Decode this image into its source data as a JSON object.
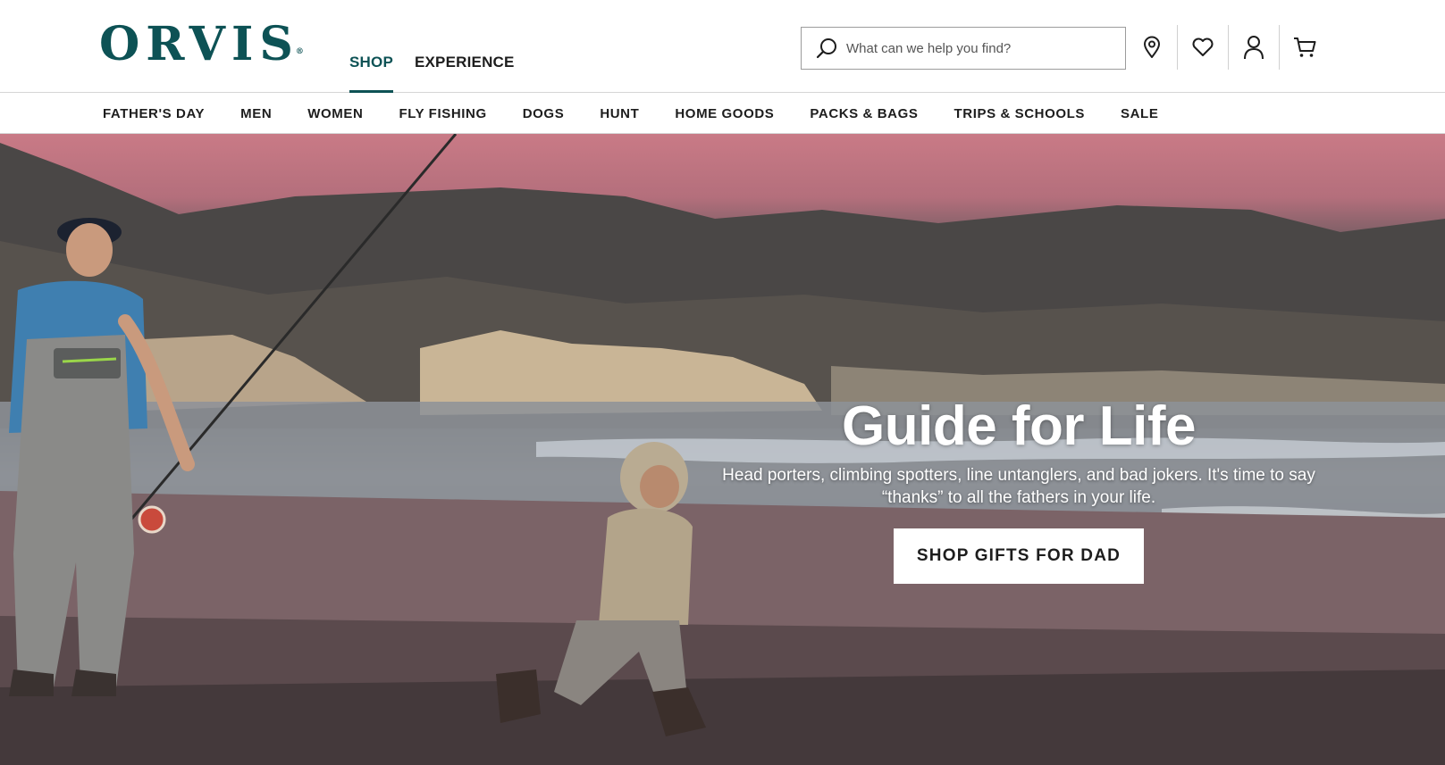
{
  "brand": {
    "logo_text": "ORVIS",
    "logo_mark": "®",
    "color": "#0d5255"
  },
  "top_nav": [
    {
      "label": "SHOP",
      "active": true
    },
    {
      "label": "EXPERIENCE",
      "active": false
    }
  ],
  "search": {
    "placeholder": "What can we help you find?",
    "value": ""
  },
  "header_icons": [
    "search-icon",
    "location-pin-icon",
    "heart-icon",
    "account-icon",
    "cart-icon"
  ],
  "categories": [
    "FATHER'S DAY",
    "MEN",
    "WOMEN",
    "FLY FISHING",
    "DOGS",
    "HUNT",
    "HOME GOODS",
    "PACKS & BAGS",
    "TRIPS & SCHOOLS",
    "SALE"
  ],
  "hero": {
    "title": "Guide for Life",
    "subtitle_line1": "Head porters, climbing spotters, line untanglers, and bad jokers. It's time to say",
    "subtitle_line2": "“thanks” to all the fathers in your life.",
    "cta_label": "SHOP GIFTS FOR DAD"
  }
}
